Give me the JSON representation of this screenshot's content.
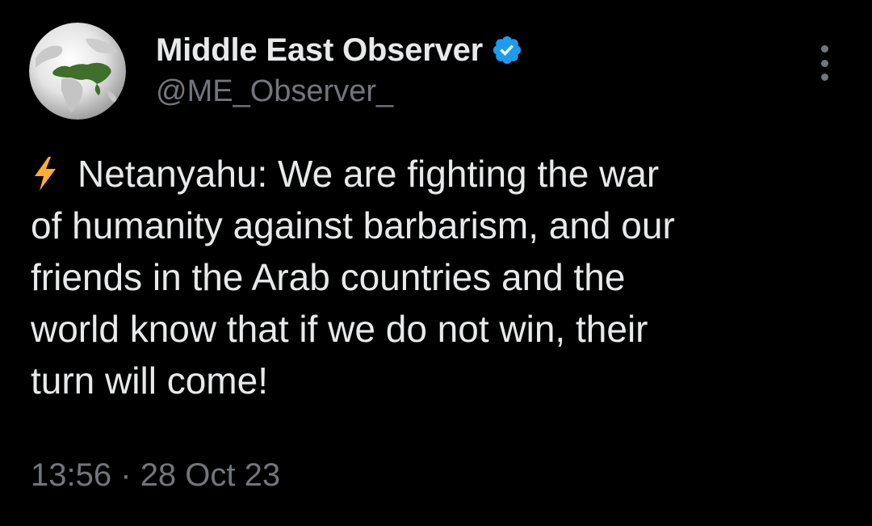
{
  "account": {
    "display_name": "Middle East Observer",
    "handle": "@ME_Observer_",
    "verified": true
  },
  "tweet": {
    "lead_icon": "lightning-bolt-icon",
    "text_lines": [
      "Netanyahu: We are fighting the war",
      "of humanity against barbarism, and our",
      "friends in the Arab countries and the",
      "world know that if we do not win, their",
      "turn will come!"
    ],
    "time": "13:56",
    "separator": "·",
    "date": "28 Oct 23"
  },
  "icons": {
    "avatar": "globe-avatar",
    "verified": "verified-badge-icon",
    "menu": "more-options-icon"
  },
  "colors": {
    "background": "#000000",
    "primary_text": "#e7e9ea",
    "secondary_text": "#71767b",
    "verified_blue": "#1d9bf0",
    "bolt_yellow": "#ffac33"
  }
}
